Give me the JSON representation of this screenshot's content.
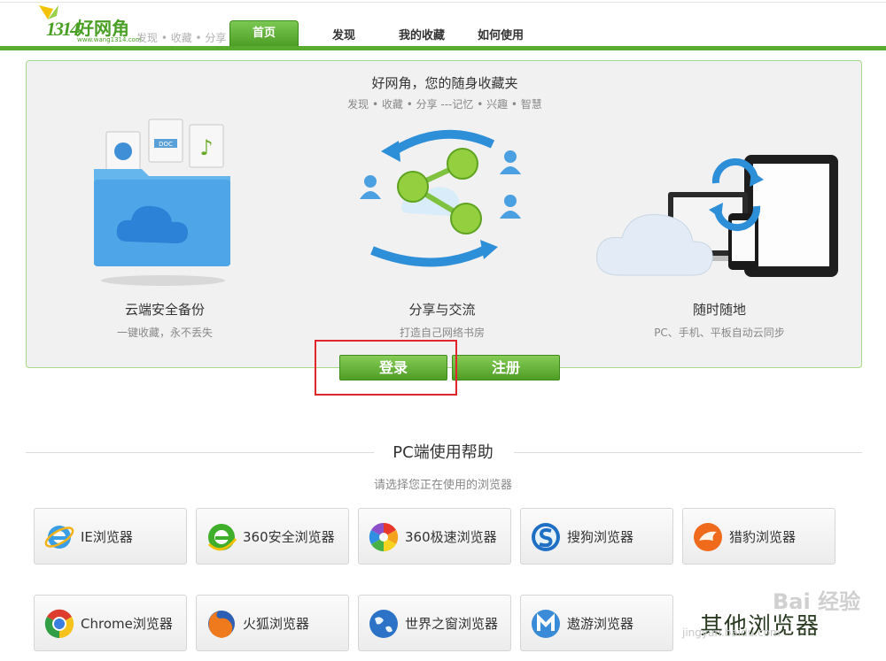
{
  "header": {
    "logo_number": "1314",
    "logo_name": "好网角",
    "logo_url": "www.wang1314.com",
    "tagline": "发现 • 收藏 • 分享",
    "tabs": [
      {
        "label": "首页",
        "active": true
      },
      {
        "label": "发现",
        "active": false
      },
      {
        "label": "我的收藏",
        "active": false
      },
      {
        "label": "如何使用",
        "active": false
      }
    ]
  },
  "hero": {
    "title": "好网角，您的随身收藏夹",
    "subtitle": "发现 • 收藏 • 分享 ---记忆 • 兴趣 • 智慧",
    "features": [
      {
        "title": "云端安全备份",
        "desc": "一键收藏，永不丢失",
        "icon": "cloud-folder-icon"
      },
      {
        "title": "分享与交流",
        "desc": "打造自己网络书房",
        "icon": "share-network-icon"
      },
      {
        "title": "随时随地",
        "desc": "PC、手机、平板自动云同步",
        "icon": "device-sync-icon"
      }
    ],
    "doc_label": "DOC",
    "login_label": "登录",
    "register_label": "注册"
  },
  "help": {
    "title": "PC端使用帮助",
    "subtitle": "请选择您正在使用的浏览器",
    "browsers": [
      {
        "label": "IE浏览器",
        "icon": "ie-icon"
      },
      {
        "label": "360安全浏览器",
        "icon": "360-safe-icon"
      },
      {
        "label": "360极速浏览器",
        "icon": "360-speed-icon"
      },
      {
        "label": "搜狗浏览器",
        "icon": "sogou-icon"
      },
      {
        "label": "猎豹浏览器",
        "icon": "liebao-icon"
      },
      {
        "label": "Chrome浏览器",
        "icon": "chrome-icon"
      },
      {
        "label": "火狐浏览器",
        "icon": "firefox-icon"
      },
      {
        "label": "世界之窗浏览器",
        "icon": "theworld-icon"
      },
      {
        "label": "遨游浏览器",
        "icon": "maxthon-icon"
      }
    ],
    "other_label": "其他浏览器"
  },
  "watermark": {
    "text": "Bai 经验",
    "url": "jingyan.baidu.com"
  },
  "colors": {
    "brand_green": "#58ab2c",
    "button_green": "#4e9d24",
    "highlight_red": "#e0262b"
  }
}
